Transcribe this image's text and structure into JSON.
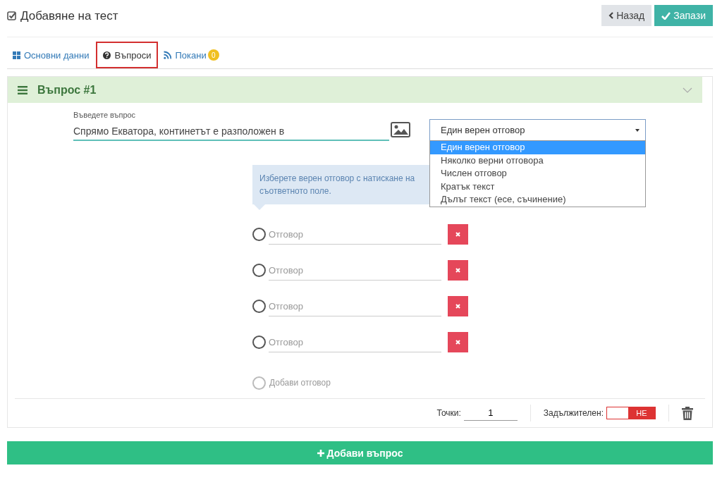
{
  "header": {
    "title": "Добавяне на тест",
    "back_button": "Назад",
    "save_button": "Запази"
  },
  "tabs": [
    {
      "label": "Основни данни",
      "kind": "grid",
      "selected": false
    },
    {
      "label": "Въпроси",
      "kind": "question",
      "selected": true
    },
    {
      "label": "Покани",
      "kind": "rss",
      "selected": false,
      "badge": "0"
    }
  ],
  "question": {
    "title": "Въпрос #1",
    "expanded": true,
    "text_label": "Въведете въпрос",
    "text_value": "Спрямо Екватора, континетът е разположен в",
    "type_select": {
      "value": "Един верен отговор",
      "expanded": true,
      "options": [
        {
          "label": "Един верен отговор",
          "selected": true
        },
        {
          "label": "Няколко верни отговора",
          "selected": false
        },
        {
          "label": "Числен отговор",
          "selected": false
        },
        {
          "label": "Кратък текст",
          "selected": false
        },
        {
          "label": "Дълъг текст (есе, съчинение)",
          "selected": false
        }
      ]
    },
    "hint": [
      "Изберете верен отговор с натискане на",
      "съответното поле."
    ],
    "answers": [
      {
        "placeholder": "Отговор",
        "checked": false
      },
      {
        "placeholder": "Отговор",
        "checked": false
      },
      {
        "placeholder": "Отговор",
        "checked": false
      },
      {
        "placeholder": "Отговор",
        "checked": false
      }
    ],
    "add_answer": "Добави отговор",
    "points_label": "Точки:",
    "points_value": "1",
    "required": {
      "label": "Задължителен:",
      "on": false,
      "state_text": "НЕ"
    }
  },
  "add_question_button": "Добави въпрос"
}
